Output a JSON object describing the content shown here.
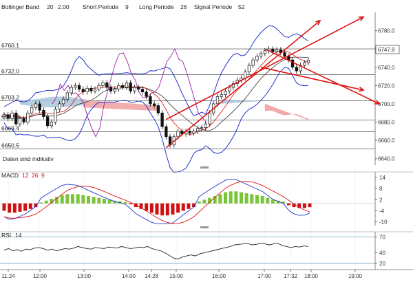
{
  "header": {
    "bollinger": {
      "label": "Bollinger Band",
      "p1": "20",
      "p2": "2.00"
    },
    "short": {
      "label": "Short Periode",
      "value": "9"
    },
    "long": {
      "label": "Long Periode",
      "value": "26"
    },
    "signal": {
      "label": "Signal Periode",
      "value": "52"
    }
  },
  "note": "Daten sind indikativ",
  "price_badge": "6747.8",
  "macd": {
    "label": "MACD",
    "p1": "12",
    "p2": "26",
    "p3": "9"
  },
  "rsi": {
    "label": "RSI",
    "p1": "14"
  },
  "colors": {
    "bollinger": "#2233cc",
    "price_line": "#a020a0",
    "trend": "#e01010",
    "histo_pos": "#7ac43a",
    "histo_neg": "#d01010",
    "cloud_blue": "#a9c6dc",
    "cloud_red": "#f0a0a0"
  },
  "chart_data": [
    {
      "type": "candlestick",
      "title": "",
      "y_ticks": [
        6640.0,
        6660.0,
        6680.0,
        6700.0,
        6720.0,
        6740.0,
        6760.0,
        6780.0
      ],
      "ylim": [
        6633,
        6800
      ],
      "x_ticks": [
        "11:24",
        "12:00",
        "13:00",
        "14:00",
        "14:28",
        "15:00",
        "16:00",
        "17:00",
        "17:32",
        "18:00",
        "19:00"
      ],
      "levels": [
        {
          "label": "6760.1",
          "value": 6760.1
        },
        {
          "label": "6732.0",
          "value": 6732.0
        },
        {
          "label": "6703.2",
          "value": 6703.2
        },
        {
          "label": "6682.3",
          "value": 6682.3
        },
        {
          "label": "6669.4",
          "value": 6669.4
        },
        {
          "label": "6650.5",
          "value": 6650.5
        }
      ],
      "last_price": 6747.8,
      "close_series": [
        6688,
        6684,
        6690,
        6678,
        6684,
        6680,
        6690,
        6696,
        6700,
        6693,
        6686,
        6676,
        6680,
        6694,
        6700,
        6705,
        6712,
        6718,
        6720,
        6716,
        6713,
        6717,
        6714,
        6716,
        6720,
        6723,
        6718,
        6714,
        6716,
        6720,
        6718,
        6723,
        6714,
        6718,
        6716,
        6713,
        6708,
        6700,
        6698,
        6690,
        6675,
        6664,
        6655,
        6664,
        6670,
        6667,
        6670,
        6668,
        6670,
        6673,
        6674,
        6678,
        6690,
        6700,
        6708,
        6710,
        6714,
        6718,
        6722,
        6726,
        6728,
        6735,
        6742,
        6748,
        6752,
        6755,
        6758,
        6760,
        6757,
        6759,
        6756,
        6752,
        6748,
        6740,
        6736,
        6742,
        6745,
        6747.8
      ]
    },
    {
      "type": "bar",
      "title": "MACD",
      "y_ticks": [
        14.0,
        8.0,
        2.0,
        -4.0,
        -10.0
      ],
      "ylim": [
        -12,
        17
      ],
      "histogram": [
        -4,
        -5,
        -5,
        -4.5,
        -4,
        -3,
        -2,
        0.5,
        1.5,
        2.5,
        3.5,
        4.5,
        5,
        5,
        5,
        4.5,
        4,
        3.5,
        3,
        2.5,
        2,
        1.5,
        1.2,
        0.8,
        -0.5,
        -2,
        -3,
        -4,
        -5,
        -6,
        -6.5,
        -6.5,
        -6,
        -5,
        -4,
        -3,
        -2,
        1,
        2,
        3,
        4,
        5,
        6,
        6.5,
        6.5,
        6,
        5.5,
        5,
        4.5,
        4,
        3,
        2,
        1.5,
        1,
        -1,
        -2,
        -2.5,
        -2.5,
        -2
      ]
    },
    {
      "type": "line",
      "title": "RSI",
      "y_ticks": [
        70.0,
        40.0,
        20.0
      ],
      "ylim": [
        8,
        80
      ],
      "values": [
        45,
        48,
        44,
        46,
        43,
        47,
        46,
        49,
        50,
        48,
        45,
        47,
        44,
        46,
        48,
        47,
        49,
        52,
        50,
        48,
        47,
        50,
        49,
        48,
        51,
        50,
        49,
        52,
        50,
        48,
        49,
        51,
        50,
        52,
        48,
        46,
        44,
        40,
        35,
        30,
        28,
        32,
        34,
        36,
        34,
        38,
        40,
        42,
        44,
        46,
        48,
        50,
        52,
        55,
        56,
        57,
        58,
        55,
        56,
        58,
        57,
        55,
        57,
        58,
        54,
        52,
        50,
        52,
        51,
        53,
        52
      ]
    }
  ]
}
